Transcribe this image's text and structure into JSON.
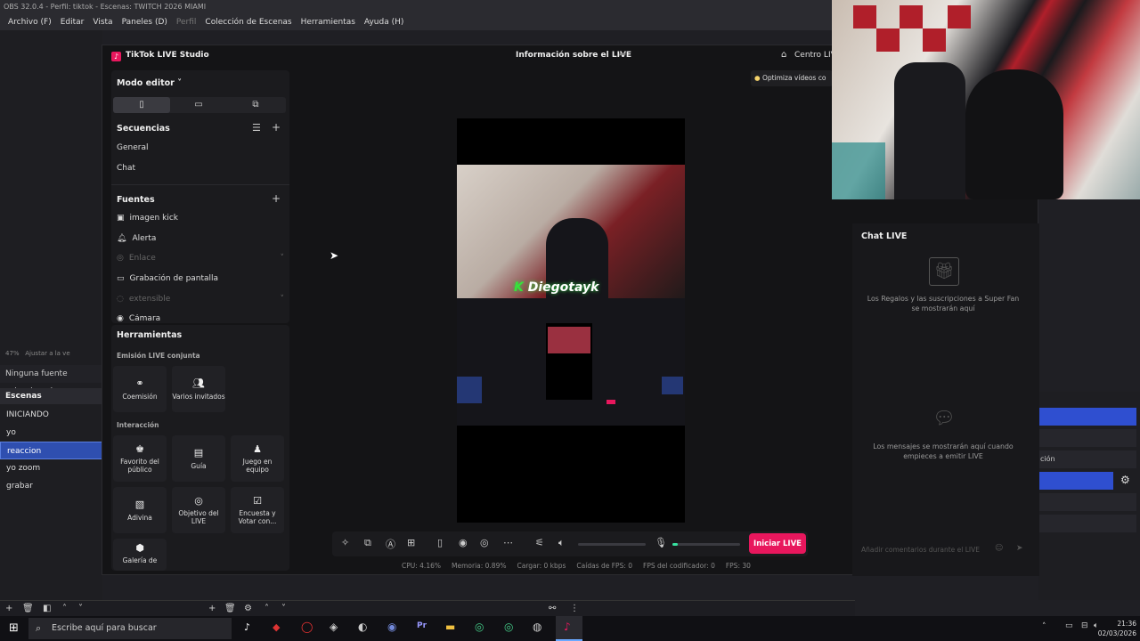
{
  "obs": {
    "title": "OBS 32.0.4 - Perfil: tiktok - Escenas: TWITCH 2026 MIAMI",
    "menu": [
      "Archivo (F)",
      "Editar",
      "Vista",
      "Paneles (D)",
      "Perfil",
      "Colección de Escenas",
      "Herramientas",
      "Ayuda (H)"
    ],
    "zoom": "47%",
    "zoom_fit": "Ajustar a la ve",
    "no_source": "Ninguna fuente seleccionada",
    "scenes_title": "Escenas",
    "scenes": [
      "INICIANDO",
      "yo",
      "reaccion",
      "yo zoom",
      "grabar"
    ],
    "selected_scene_index": 2,
    "right_partial_label": "ción"
  },
  "tiktok": {
    "app_title": "TikTok LIVE Studio",
    "center_title": "Información sobre el LIVE",
    "centro_label": "Centro LIV",
    "optimize_tip": "Optimiza vídeos co",
    "editor_mode": "Modo editor",
    "sequences_title": "Secuencias",
    "sequences": [
      "General",
      "Chat"
    ],
    "sources_title": "Fuentes",
    "sources": [
      {
        "label": "imagen kick",
        "dim": false,
        "icon": "image-icon"
      },
      {
        "label": "Alerta",
        "dim": false,
        "icon": "bell-icon"
      },
      {
        "label": "Enlace",
        "dim": true,
        "icon": "globe-icon"
      },
      {
        "label": "Grabación de pantalla",
        "dim": false,
        "icon": "monitor-icon"
      },
      {
        "label": "extensible",
        "dim": true,
        "icon": "puzzle-icon"
      },
      {
        "label": "Cámara",
        "dim": false,
        "icon": "camera-icon"
      }
    ],
    "tools_title": "Herramientas",
    "joint_live_title": "Emisión LIVE conjunta",
    "joint_tools": [
      "Coemisión",
      "Varios invitados"
    ],
    "interaction_title": "Interacción",
    "interaction_tools": [
      "Favorito del público",
      "Guía",
      "Juego en equipo",
      "Adivina",
      "Objetivo del LIVE",
      "Encuesta y Votar con...",
      "Galería de"
    ],
    "start_button": "Iniciar LIVE",
    "overlay_name": "Diegotayk",
    "stats": {
      "cpu": "CPU: 4.16%",
      "mem": "Memoria: 0.89%",
      "load": "Cargar: 0 kbps",
      "fps_drop": "Caídas de FPS: 0",
      "encoder_fps": "FPS del codificador: 0",
      "fps": "FPS: 30"
    },
    "chat_title": "Chat LIVE",
    "gifts_text": "Los Regalos y las suscripciones a Super Fan se mostrarán aquí",
    "messages_text": "Los mensajes se mostrarán aquí cuando empieces a emitir LIVE",
    "comment_placeholder": "Añadir comentarios durante el LIVE"
  },
  "taskbar": {
    "search_placeholder": "Escribe aquí para buscar",
    "time": "21:36",
    "date": "02/03/2026"
  },
  "colors": {
    "accent": "#e8175d",
    "obs_select": "#2f4fb0"
  }
}
